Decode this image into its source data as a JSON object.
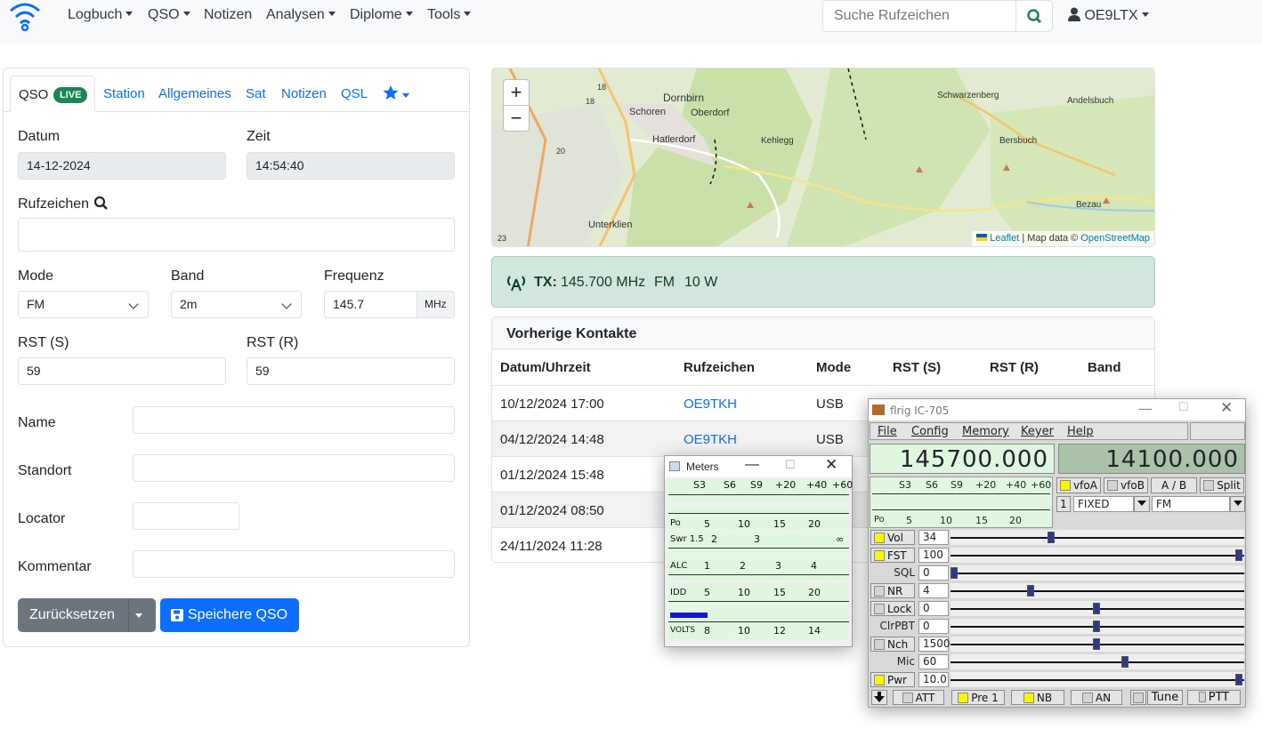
{
  "navbar": {
    "brand_icon": "wifi-icon",
    "menus": [
      "Logbuch",
      "QSO",
      "Notizen",
      "Analysen",
      "Diplome",
      "Tools"
    ],
    "search_placeholder": "Suche Rufzeichen",
    "user": "OE9LTX"
  },
  "qso": {
    "tabs": {
      "qso": "QSO",
      "live_badge": "LIVE",
      "station": "Station",
      "allgemeines": "Allgemeines",
      "sat": "Sat",
      "notizen": "Notizen",
      "qsl": "QSL"
    },
    "labels": {
      "datum": "Datum",
      "zeit": "Zeit",
      "rufzeichen": "Rufzeichen",
      "mode": "Mode",
      "band": "Band",
      "frequenz": "Frequenz",
      "rst_s": "RST (S)",
      "rst_r": "RST (R)",
      "name": "Name",
      "standort": "Standort",
      "locator": "Locator",
      "kommentar": "Kommentar"
    },
    "values": {
      "datum": "14-12-2024",
      "zeit": "14:54:40",
      "rufzeichen": "",
      "mode": "FM",
      "band": "2m",
      "frequenz": "145.7",
      "freq_unit": "MHz",
      "rst_s": "59",
      "rst_r": "59",
      "name": "",
      "standort": "",
      "locator": "",
      "kommentar": ""
    },
    "buttons": {
      "reset": "Zurücksetzen",
      "save": "Speichere QSO"
    }
  },
  "map": {
    "places": [
      "Dornbirn",
      "Schoren",
      "Oberdorf",
      "Hatlerdorf",
      "Kehlegg",
      "Schwarzenberg",
      "Andelsbuch",
      "Bersbuch",
      "Bezau",
      "Unterklien"
    ],
    "road_numbers": [
      "18",
      "18",
      "20",
      "23"
    ],
    "zoom_in": "+",
    "zoom_out": "−",
    "attribution_leaflet": "Leaflet",
    "attribution_mid": " | Map data © ",
    "attribution_osm": "OpenStreetMap"
  },
  "tx": {
    "icon": "antenna-icon",
    "label": "TX:",
    "frequency": "145.700 MHz",
    "mode": "FM",
    "power": "10 W"
  },
  "contacts": {
    "title": "Vorherige Kontakte",
    "headers": [
      "Datum/Uhrzeit",
      "Rufzeichen",
      "Mode",
      "RST (S)",
      "RST (R)",
      "Band"
    ],
    "rows": [
      {
        "datetime": "10/12/2024 17:00",
        "call": "OE9TKH",
        "mode": "USB"
      },
      {
        "datetime": "04/12/2024 14:48",
        "call": "OE9TKH",
        "mode": "USB"
      },
      {
        "datetime": "01/12/2024 15:48",
        "call": "",
        "mode": ""
      },
      {
        "datetime": "01/12/2024 08:50",
        "call": "",
        "mode": ""
      },
      {
        "datetime": "24/11/2024 11:28",
        "call": "",
        "mode": ""
      }
    ]
  },
  "meters": {
    "title": "Meters",
    "s_scale": [
      "S3",
      "S6",
      "S9",
      "+20",
      "+40",
      "+60"
    ],
    "po_scale": [
      "Po",
      "5",
      "10",
      "15",
      "20"
    ],
    "swr_scale": [
      "Swr 1.5",
      "2",
      "3",
      "∞"
    ],
    "alc_scale": [
      "ALC",
      "1",
      "2",
      "3",
      "4"
    ],
    "idd_scale": [
      "IDD",
      "5",
      "10",
      "15",
      "20"
    ],
    "volts_scale": [
      "VOLTS",
      "8",
      "10",
      "12",
      "14"
    ]
  },
  "flrig": {
    "title": "flrig IC-705",
    "menu": [
      "File",
      "Config",
      "Memory",
      "Keyer",
      "Help"
    ],
    "vfo_a": "145700.000",
    "vfo_b": "14100.000",
    "buttons": {
      "vfoA": "vfoA",
      "vfoB": "vfoB",
      "ab": "A / B",
      "split": "Split",
      "mem": "1",
      "att": "ATT",
      "pre": "Pre 1",
      "nb": "NB",
      "an": "AN",
      "tune": "Tune",
      "ptt": "PTT"
    },
    "filter": "FIXED",
    "mode": "FM",
    "controls": [
      {
        "label": "Vol",
        "value": "34",
        "led": true,
        "level": 0.34
      },
      {
        "label": "FST",
        "value": "100",
        "led": true,
        "level": 1.0
      },
      {
        "label": "SQL",
        "value": "0",
        "led": null,
        "level": 0.0
      },
      {
        "label": "NR",
        "value": "4",
        "led": false,
        "level": 0.27
      },
      {
        "label": "Lock",
        "value": "0",
        "led": false,
        "level": 0.5
      },
      {
        "label": "ClrPBT",
        "value": "0",
        "led": null,
        "level": 0.5
      },
      {
        "label": "Nch",
        "value": "1500",
        "led": false,
        "level": 0.5
      },
      {
        "label": "Mic",
        "value": "60",
        "led": null,
        "level": 0.6
      },
      {
        "label": "Pwr",
        "value": "10.0",
        "led": true,
        "level": 1.0
      }
    ]
  }
}
